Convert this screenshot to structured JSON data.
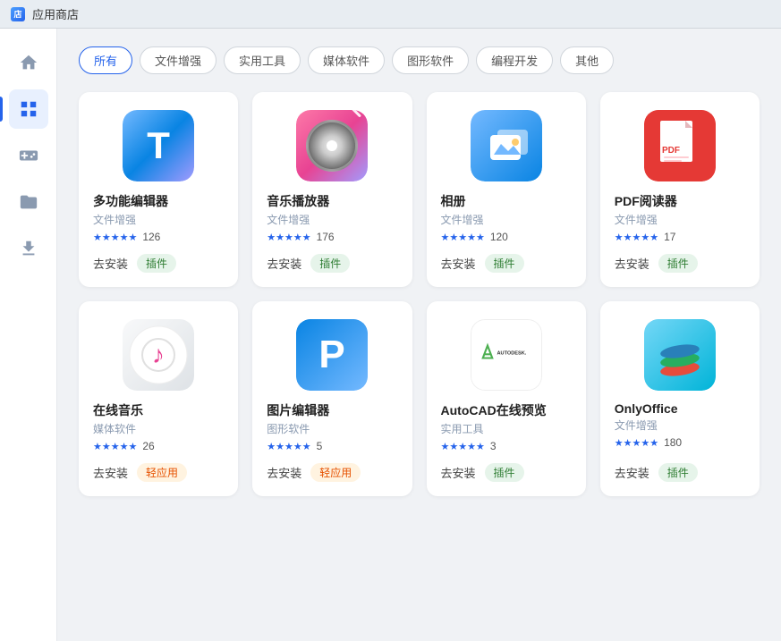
{
  "titleBar": {
    "icon": "店",
    "title": "应用商店"
  },
  "sidebar": {
    "items": [
      {
        "id": "home",
        "icon": "⌂",
        "label": "首页",
        "active": false
      },
      {
        "id": "apps",
        "icon": "⊞",
        "label": "应用",
        "active": true
      },
      {
        "id": "games",
        "icon": "⚙",
        "label": "游戏",
        "active": false
      },
      {
        "id": "files",
        "icon": "□",
        "label": "文件",
        "active": false
      },
      {
        "id": "download",
        "icon": "↓",
        "label": "下载",
        "active": false
      }
    ]
  },
  "filterTabs": [
    {
      "id": "all",
      "label": "所有",
      "active": true
    },
    {
      "id": "file-enhance",
      "label": "文件增强",
      "active": false
    },
    {
      "id": "tools",
      "label": "实用工具",
      "active": false
    },
    {
      "id": "media",
      "label": "媒体软件",
      "active": false
    },
    {
      "id": "graphics",
      "label": "图形软件",
      "active": false
    },
    {
      "id": "dev",
      "label": "编程开发",
      "active": false
    },
    {
      "id": "other",
      "label": "其他",
      "active": false
    }
  ],
  "apps": [
    {
      "id": "editor",
      "name": "多功能编辑器",
      "category": "文件增强",
      "stars": 5,
      "ratingCount": "126",
      "installLabel": "去安装",
      "badgeLabel": "插件",
      "badgeType": "plugin",
      "iconType": "editor"
    },
    {
      "id": "music-player",
      "name": "音乐播放器",
      "category": "文件增强",
      "stars": 5,
      "ratingCount": "176",
      "installLabel": "去安装",
      "badgeLabel": "插件",
      "badgeType": "plugin",
      "iconType": "music"
    },
    {
      "id": "photos",
      "name": "相册",
      "category": "文件增强",
      "stars": 5,
      "ratingCount": "120",
      "installLabel": "去安装",
      "badgeLabel": "插件",
      "badgeType": "plugin",
      "iconType": "photos"
    },
    {
      "id": "pdf-reader",
      "name": "PDF阅读器",
      "category": "文件增强",
      "stars": 5,
      "ratingCount": "17",
      "installLabel": "去安装",
      "badgeLabel": "插件",
      "badgeType": "plugin",
      "iconType": "pdf"
    },
    {
      "id": "online-music",
      "name": "在线音乐",
      "category": "媒体软件",
      "stars": 5,
      "ratingCount": "26",
      "installLabel": "去安装",
      "badgeLabel": "轻应用",
      "badgeType": "light-app",
      "iconType": "online-music"
    },
    {
      "id": "pic-editor",
      "name": "图片编辑器",
      "category": "图形软件",
      "stars": 5,
      "ratingCount": "5",
      "installLabel": "去安装",
      "badgeLabel": "轻应用",
      "badgeType": "light-app",
      "iconType": "pic-editor"
    },
    {
      "id": "autocad",
      "name": "AutoCAD在线预览",
      "category": "实用工具",
      "stars": 5,
      "ratingCount": "3",
      "installLabel": "去安装",
      "badgeLabel": "插件",
      "badgeType": "plugin",
      "iconType": "autocad"
    },
    {
      "id": "onlyoffice",
      "name": "OnlyOffice",
      "category": "文件增强",
      "stars": 5,
      "ratingCount": "180",
      "installLabel": "去安装",
      "badgeLabel": "插件",
      "badgeType": "plugin",
      "iconType": "onlyoffice"
    }
  ],
  "colors": {
    "accent": "#2563eb",
    "plugin_bg": "#e6f4ea",
    "plugin_text": "#2e7d32",
    "light_app_bg": "#fff3e0",
    "light_app_text": "#e65100"
  }
}
